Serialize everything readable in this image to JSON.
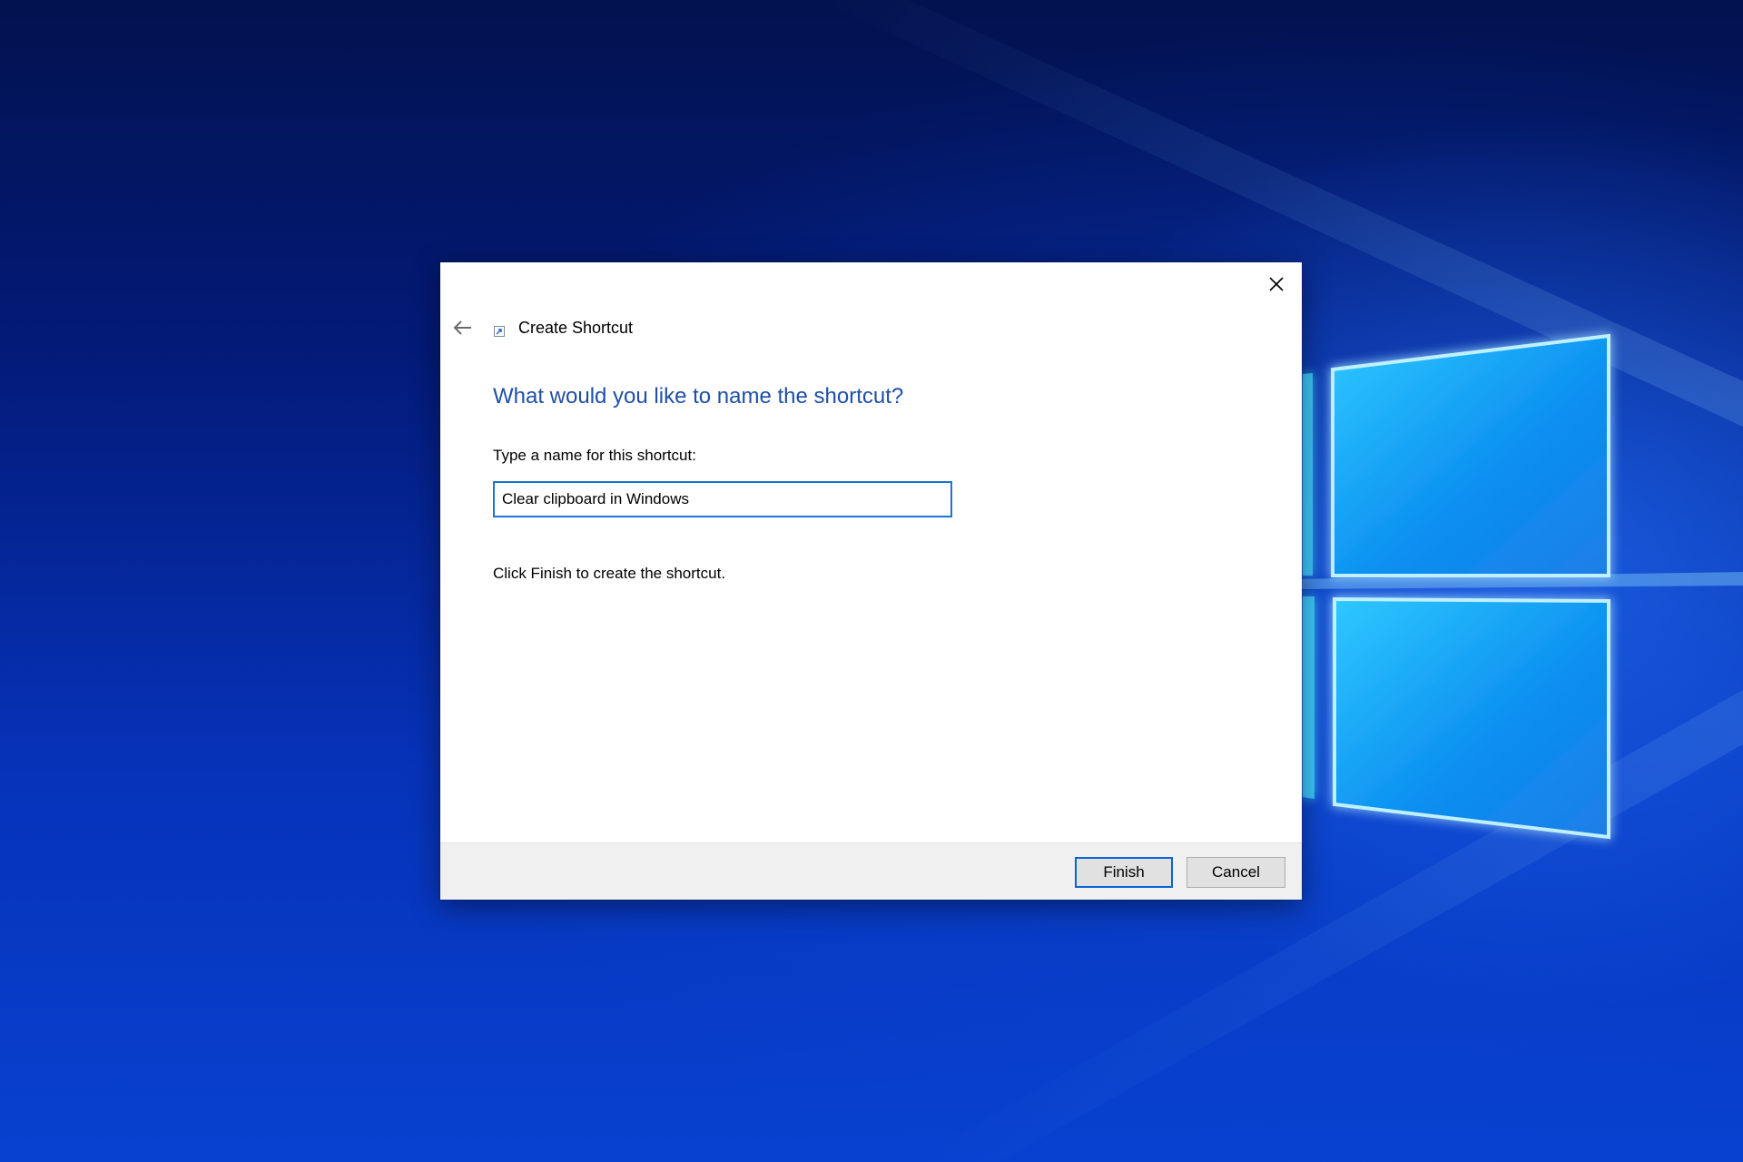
{
  "dialog": {
    "title": "Create Shortcut",
    "heading": "What would you like to name the shortcut?",
    "field_label": "Type a name for this shortcut:",
    "name_value": "Clear clipboard in Windows",
    "instruction": "Click Finish to create the shortcut.",
    "finish_label": "Finish",
    "cancel_label": "Cancel"
  },
  "icons": {
    "close": "close-icon",
    "back": "back-arrow-icon",
    "app": "shortcut-icon"
  },
  "colors": {
    "heading": "#1e4fa8",
    "input_border": "#1a73d6",
    "footer_bg": "#f0f0f0",
    "desktop_bg": "#0632b8"
  }
}
